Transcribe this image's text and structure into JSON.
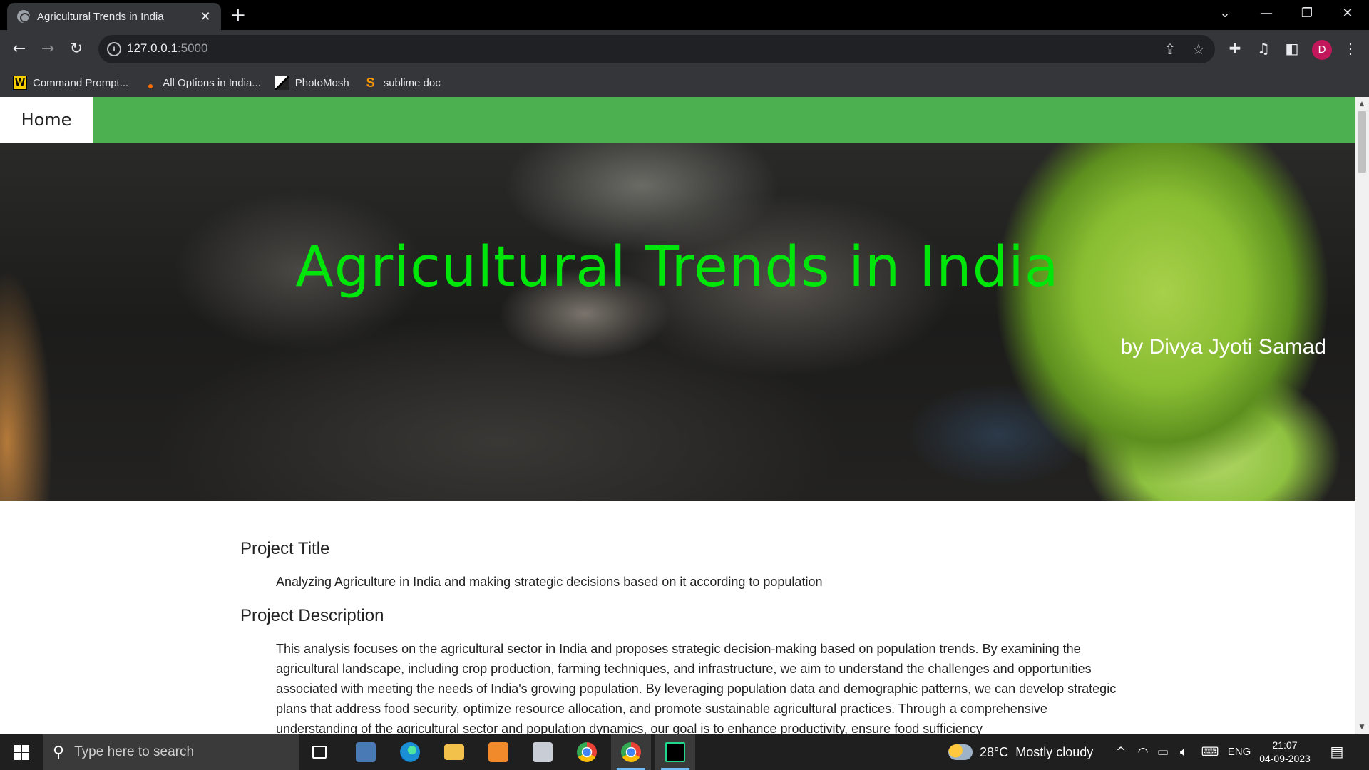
{
  "browser": {
    "tab_title": "Agricultural Trends in India",
    "tab_close": "✕",
    "new_tab": "+",
    "url_host": "127.0.0.1",
    "url_port": ":5000",
    "profile_initial": "D"
  },
  "bookmarks": [
    {
      "label": "Command Prompt...",
      "icon": "w-icon",
      "glyph": "W"
    },
    {
      "label": "All Options in India...",
      "icon": "dot-icon",
      "glyph": ""
    },
    {
      "label": "PhotoMosh",
      "icon": "photomosh-icon",
      "glyph": ""
    },
    {
      "label": "sublime doc",
      "icon": "sublime-icon",
      "glyph": "S"
    }
  ],
  "page": {
    "nav_home": "Home",
    "hero_title": "Agricultural Trends in India",
    "hero_subtitle": "by Divya Jyoti Samad",
    "sections": [
      {
        "heading": "Project Title",
        "body": "Analyzing Agriculture in India and making strategic decisions based on it according to population"
      },
      {
        "heading": "Project Description",
        "body": "This analysis focuses on the agricultural sector in India and proposes strategic decision-making based on population trends. By examining the agricultural landscape, including crop production, farming techniques, and infrastructure, we aim to understand the challenges and opportunities associated with meeting the needs of India's growing population. By leveraging population data and demographic patterns, we can develop strategic plans that address food security, optimize resource allocation, and promote sustainable agricultural practices. Through a comprehensive understanding of the agricultural sector and population dynamics, our goal is to enhance productivity, ensure food sufficiency"
      }
    ]
  },
  "taskbar": {
    "search_placeholder": "Type here to search",
    "weather_temp": "28°C",
    "weather_desc": "Mostly cloudy",
    "lang": "ENG",
    "time": "21:07",
    "date": "04-09-2023"
  },
  "colors": {
    "navbar": "#4caf50",
    "hero_title": "#00e60a"
  }
}
